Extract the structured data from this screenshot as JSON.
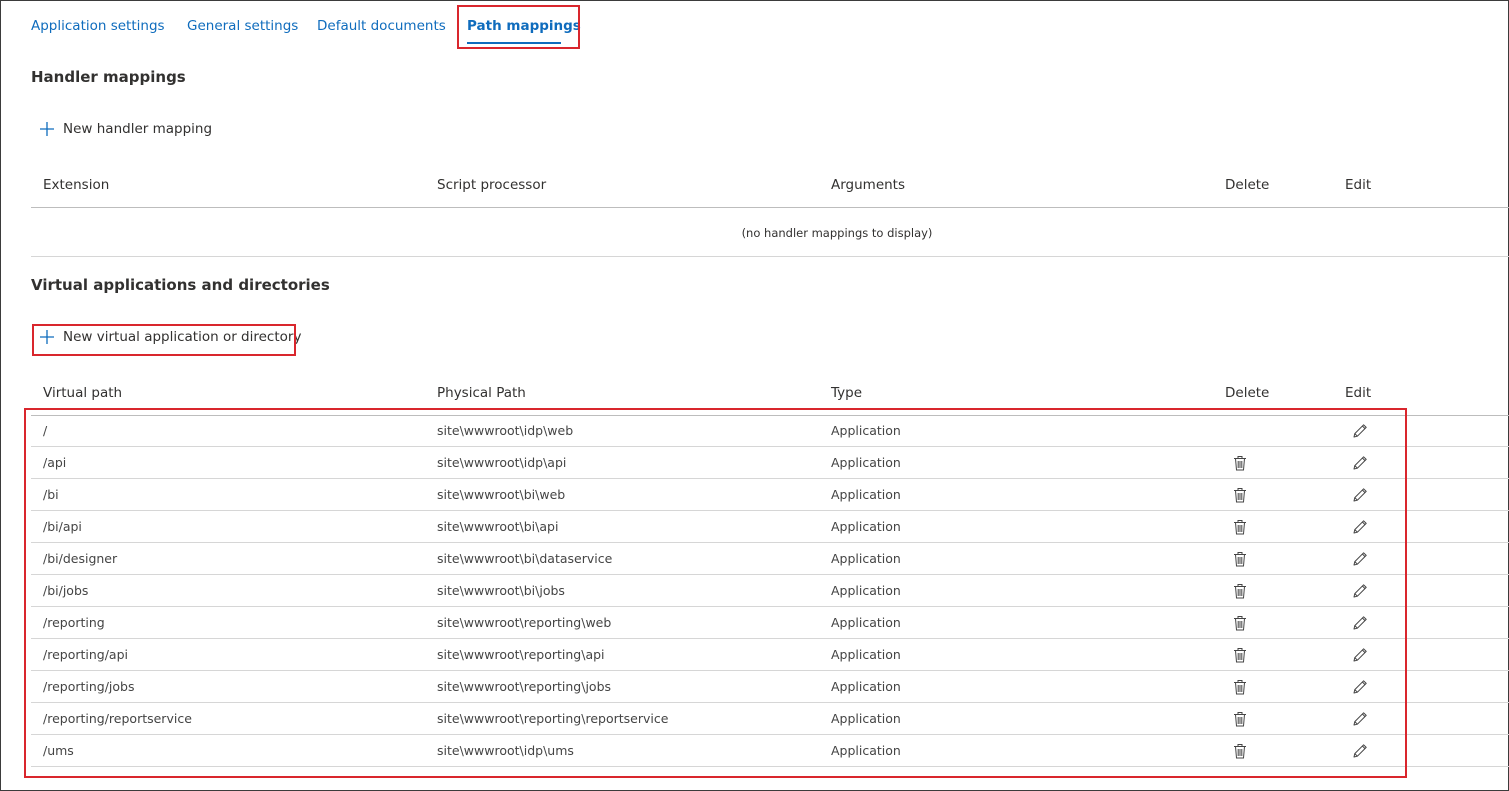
{
  "tabs": [
    {
      "label": "Application settings",
      "active": false
    },
    {
      "label": "General settings",
      "active": false
    },
    {
      "label": "Default documents",
      "active": false
    },
    {
      "label": "Path mappings",
      "active": true
    }
  ],
  "handler_mappings": {
    "title": "Handler mappings",
    "new_label": "New handler mapping",
    "columns": [
      "Extension",
      "Script processor",
      "Arguments",
      "Delete",
      "Edit"
    ],
    "empty_message": "(no handler mappings to display)"
  },
  "virtual_apps": {
    "title": "Virtual applications and directories",
    "new_label": "New virtual application or directory",
    "columns": [
      "Virtual path",
      "Physical Path",
      "Type",
      "Delete",
      "Edit"
    ],
    "rows": [
      {
        "virtual_path": "/",
        "physical_path": "site\\wwwroot\\idp\\web",
        "type": "Application",
        "deletable": false
      },
      {
        "virtual_path": "/api",
        "physical_path": "site\\wwwroot\\idp\\api",
        "type": "Application",
        "deletable": true
      },
      {
        "virtual_path": "/bi",
        "physical_path": "site\\wwwroot\\bi\\web",
        "type": "Application",
        "deletable": true
      },
      {
        "virtual_path": "/bi/api",
        "physical_path": "site\\wwwroot\\bi\\api",
        "type": "Application",
        "deletable": true
      },
      {
        "virtual_path": "/bi/designer",
        "physical_path": "site\\wwwroot\\bi\\dataservice",
        "type": "Application",
        "deletable": true
      },
      {
        "virtual_path": "/bi/jobs",
        "physical_path": "site\\wwwroot\\bi\\jobs",
        "type": "Application",
        "deletable": true
      },
      {
        "virtual_path": "/reporting",
        "physical_path": "site\\wwwroot\\reporting\\web",
        "type": "Application",
        "deletable": true
      },
      {
        "virtual_path": "/reporting/api",
        "physical_path": "site\\wwwroot\\reporting\\api",
        "type": "Application",
        "deletable": true
      },
      {
        "virtual_path": "/reporting/jobs",
        "physical_path": "site\\wwwroot\\reporting\\jobs",
        "type": "Application",
        "deletable": true
      },
      {
        "virtual_path": "/reporting/reportservice",
        "physical_path": "site\\wwwroot\\reporting\\reportservice",
        "type": "Application",
        "deletable": true
      },
      {
        "virtual_path": "/ums",
        "physical_path": "site\\wwwroot\\idp\\ums",
        "type": "Application",
        "deletable": true
      }
    ]
  },
  "icons": {
    "new": "plus-icon",
    "delete": "trash-icon",
    "edit": "pencil-icon"
  },
  "colors": {
    "accent": "#0f6cbd",
    "highlight": "#d9262d",
    "text": "#323130"
  }
}
